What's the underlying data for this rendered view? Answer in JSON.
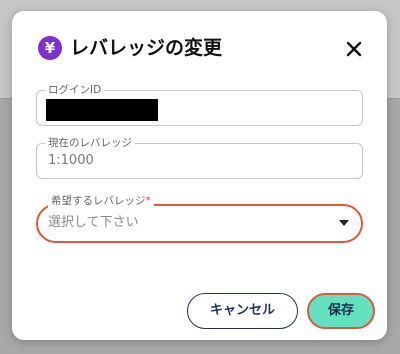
{
  "dialog": {
    "title": "レバレッジの変更",
    "icon_glyph": "¥",
    "header_icon": "yen-icon",
    "close_icon": "close-icon"
  },
  "fields": {
    "login_id": {
      "label": "ログインID",
      "value_redacted": true
    },
    "current_leverage": {
      "label": "現在のレバレッジ",
      "value": "1:1000"
    },
    "desired_leverage": {
      "label": "希望するレバレッジ",
      "required_mark": "*",
      "placeholder": "選択して下さい"
    }
  },
  "buttons": {
    "cancel": "キャンセル",
    "save": "保存"
  },
  "colors": {
    "accent_purple": "#7d2fd0",
    "save_green": "#63e0bd",
    "focus_red": "#e2563a",
    "navy": "#23325a"
  }
}
